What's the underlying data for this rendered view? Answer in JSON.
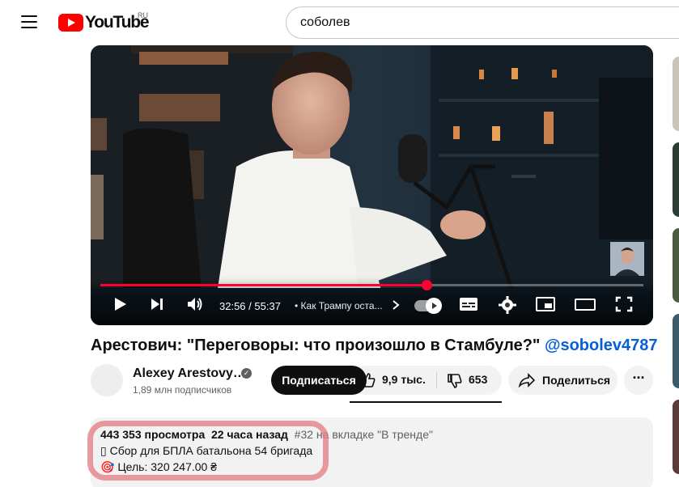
{
  "header": {
    "logo_text": "YouTube",
    "country_code": "RU",
    "search_value": "соболев"
  },
  "player": {
    "time_display": "32:56 / 55:37",
    "chapter_title": "• Как Трампу оста...",
    "progress_fraction": 0.6,
    "accent_color": "#ff0033"
  },
  "video": {
    "title_main": "Арестович: \"Переговоры: что произошло в Стамбуле?\"",
    "title_tag": "@sobolev4787"
  },
  "channel": {
    "name": "Alexey Arestovy…",
    "subscribers": "1,89 млн подписчиков",
    "subscribe_label": "Подписаться"
  },
  "actions": {
    "likes": "9,9 тыс.",
    "dislikes": "653",
    "share_label": "Поделиться"
  },
  "description": {
    "views": "443 353 просмотра",
    "age": "22 часа назад",
    "trending": "#32 на вкладке \"В тренде\"",
    "line2_icon": "▯",
    "line2_text": " Сбор для БПЛА батальона 54 бригада",
    "line3_icon": "🎯",
    "line3_text": " Цель: 320 247.00 ₴"
  },
  "icons": {
    "menu": "hamburger-icon",
    "play": "play-icon",
    "next": "next-icon",
    "volume": "volume-icon",
    "subtitles": "subtitles-icon",
    "settings": "gear-icon",
    "miniplayer": "miniplayer-icon",
    "theater": "theater-icon",
    "fullscreen": "fullscreen-icon",
    "like": "thumbs-up-icon",
    "dislike": "thumbs-down-icon",
    "share": "share-icon",
    "more": "more-icon"
  }
}
